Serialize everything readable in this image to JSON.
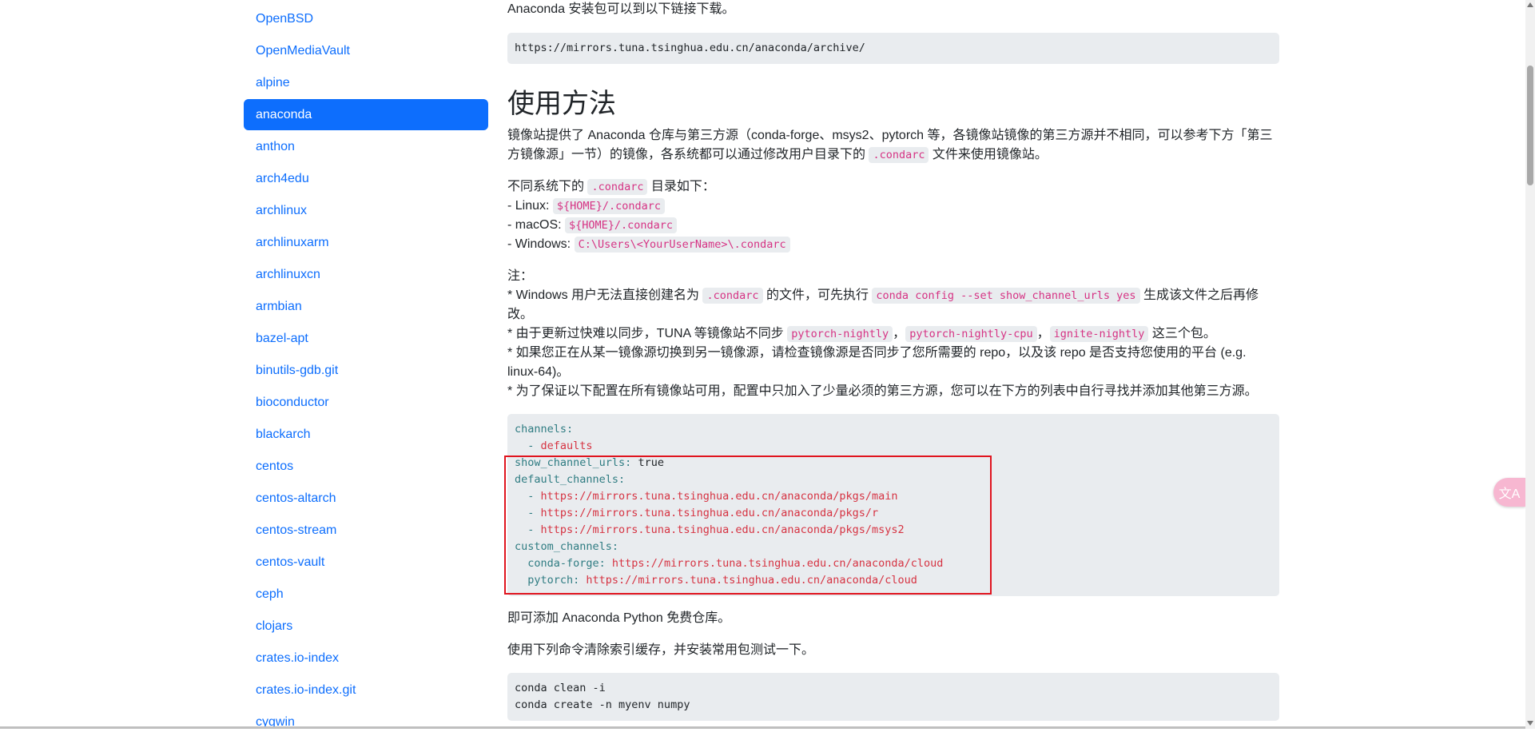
{
  "sidebar": {
    "items": [
      {
        "label": "OpenBSD",
        "active": false
      },
      {
        "label": "OpenMediaVault",
        "active": false
      },
      {
        "label": "alpine",
        "active": false
      },
      {
        "label": "anaconda",
        "active": true
      },
      {
        "label": "anthon",
        "active": false
      },
      {
        "label": "arch4edu",
        "active": false
      },
      {
        "label": "archlinux",
        "active": false
      },
      {
        "label": "archlinuxarm",
        "active": false
      },
      {
        "label": "archlinuxcn",
        "active": false
      },
      {
        "label": "armbian",
        "active": false
      },
      {
        "label": "bazel-apt",
        "active": false
      },
      {
        "label": "binutils-gdb.git",
        "active": false
      },
      {
        "label": "bioconductor",
        "active": false
      },
      {
        "label": "blackarch",
        "active": false
      },
      {
        "label": "centos",
        "active": false
      },
      {
        "label": "centos-altarch",
        "active": false
      },
      {
        "label": "centos-stream",
        "active": false
      },
      {
        "label": "centos-vault",
        "active": false
      },
      {
        "label": "ceph",
        "active": false
      },
      {
        "label": "clojars",
        "active": false
      },
      {
        "label": "crates.io-index",
        "active": false
      },
      {
        "label": "crates.io-index.git",
        "active": false
      },
      {
        "label": "cygwin",
        "active": false
      }
    ]
  },
  "main": {
    "intro_text": "Anaconda 安装包可以到以下链接下载。",
    "archive_url": "https://mirrors.tuna.tsinghua.edu.cn/anaconda/archive/",
    "usage_heading": "使用方法",
    "usage_p1_a": "镜像站提供了 Anaconda 仓库与第三方源（conda-forge、msys2、pytorch 等，各镜像站镜像的第三方源并不相同，可以参考下方「第三方镜像源」一节）的镜像，各系统都可以通过修改用户目录下的 ",
    "usage_p1_code": ".condarc",
    "usage_p1_b": " 文件来使用镜像站。",
    "dirs_label_a": "不同系统下的 ",
    "dirs_label_code": ".condarc",
    "dirs_label_b": " 目录如下：",
    "linux_label": "- Linux: ",
    "linux_path": "${HOME}/.condarc",
    "macos_label": "- macOS: ",
    "macos_path": "${HOME}/.condarc",
    "windows_label": "- Windows: ",
    "windows_path": "C:\\Users\\<YourUserName>\\.condarc",
    "notes_label": "注：",
    "note1_a": "* Windows 用户无法直接创建名为 ",
    "note1_code1": ".condarc",
    "note1_b": " 的文件，可先执行 ",
    "note1_code2": "conda config --set show_channel_urls yes",
    "note1_c": " 生成该文件之后再修改。",
    "note2_a": "* 由于更新过快难以同步，TUNA 等镜像站不同步 ",
    "note2_code1": "pytorch-nightly",
    "note2_sep": "，",
    "note2_code2": "pytorch-nightly-cpu",
    "note2_code3": "ignite-nightly",
    "note2_b": " 这三个包。",
    "note3": "* 如果您正在从某一镜像源切换到另一镜像源，请检查镜像源是否同步了您所需要的 repo，以及该 repo 是否支持您使用的平台 (e.g. linux-64)。",
    "note4": "* 为了保证以下配置在所有镜像站可用，配置中只加入了少量必须的第三方源，您可以在下方的列表中自行寻找并添加其他第三方源。",
    "config_lines": [
      {
        "key": "channels:",
        "val": ""
      },
      {
        "key": "  - ",
        "val": "defaults"
      },
      {
        "key": "show_channel_urls:",
        "val": " true"
      },
      {
        "key": "default_channels:",
        "val": ""
      },
      {
        "key": "  - ",
        "val": "https://mirrors.tuna.tsinghua.edu.cn/anaconda/pkgs/main"
      },
      {
        "key": "  - ",
        "val": "https://mirrors.tuna.tsinghua.edu.cn/anaconda/pkgs/r"
      },
      {
        "key": "  - ",
        "val": "https://mirrors.tuna.tsinghua.edu.cn/anaconda/pkgs/msys2"
      },
      {
        "key": "custom_channels:",
        "val": ""
      },
      {
        "key": "  conda-forge:",
        "val": " https://mirrors.tuna.tsinghua.edu.cn/anaconda/cloud"
      },
      {
        "key": "  pytorch:",
        "val": " https://mirrors.tuna.tsinghua.edu.cn/anaconda/cloud"
      }
    ],
    "after_config": "即可添加 Anaconda Python 免费仓库。",
    "clean_text": "使用下列命令清除索引缓存，并安装常用包测试一下。",
    "cmd_lines": [
      "conda clean -i",
      "conda create -n myenv numpy"
    ]
  },
  "translate_button": {
    "icon": "translate-icon",
    "color": "#f7b7d1"
  },
  "colors": {
    "accent": "#0d6efd",
    "highlight_border": "#e0141e",
    "code_text": "#d63384"
  }
}
